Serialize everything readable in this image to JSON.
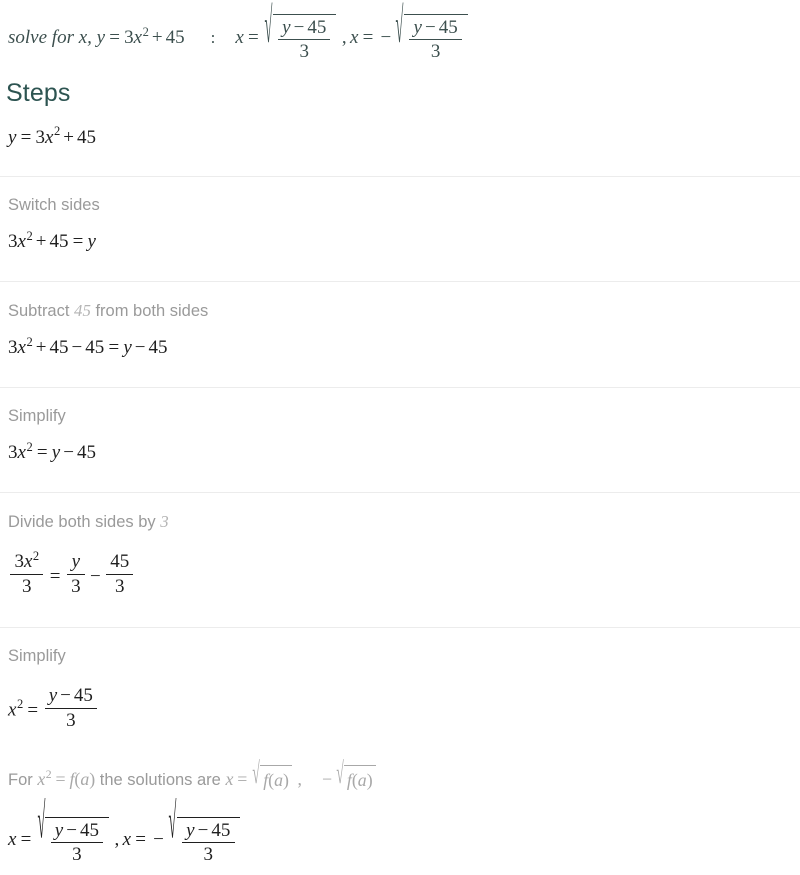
{
  "header": {
    "query": "solve for x, y = 3x2 + 45",
    "query_parts": {
      "prefix": "solve for x, y",
      "equals": "=",
      "coef": "3",
      "var": "x",
      "exponent": "2",
      "plus": "+",
      "constant": "45"
    },
    "separator": ":",
    "answer": {
      "x_label": "x",
      "equals": "=",
      "numerator_var": "y",
      "numerator_op": "−",
      "numerator_num": "45",
      "denominator": "3",
      "comma": ",",
      "minus": "−"
    }
  },
  "steps_heading": "Steps",
  "steps": [
    {
      "id": "initial",
      "label": null,
      "expression": "y = 3x2 + 45"
    },
    {
      "id": "switch-sides",
      "label": "Switch sides",
      "expression": "3x2 + 45 = y"
    },
    {
      "id": "subtract-45",
      "label_before": "Subtract",
      "label_value": "45",
      "label_after": "from both sides",
      "expression": "3x2 + 45 − 45 = y − 45"
    },
    {
      "id": "simplify-1",
      "label": "Simplify",
      "expression": "3x2 = y − 45"
    },
    {
      "id": "divide-by-3",
      "label_before": "Divide both sides by",
      "label_value": "3",
      "label_after": "",
      "expression": "3x2/3 = y/3 − 45/3"
    },
    {
      "id": "simplify-2",
      "label": "Simplify",
      "expression": "x2 = (y − 45)/3"
    }
  ],
  "note": {
    "for_word": "For",
    "lhs_var": "x",
    "lhs_exp": "2",
    "equals": "=",
    "fn": "f",
    "fn_open": "(",
    "fn_arg": "a",
    "fn_close": ")",
    "middle": "the solutions are",
    "x_label": "x",
    "comma": ",",
    "minus": "−"
  },
  "final": {
    "x_label": "x",
    "equals": "=",
    "numerator_var": "y",
    "numerator_op": "−",
    "numerator_num": "45",
    "denominator": "3",
    "comma": ",",
    "minus": "−"
  },
  "colors": {
    "heading": "#2d5451",
    "header_text": "#3c4f4e",
    "label_grey": "#9a9a9a",
    "math_black": "#1f1f1f",
    "divider": "#ececec",
    "background": "#ffffff"
  }
}
